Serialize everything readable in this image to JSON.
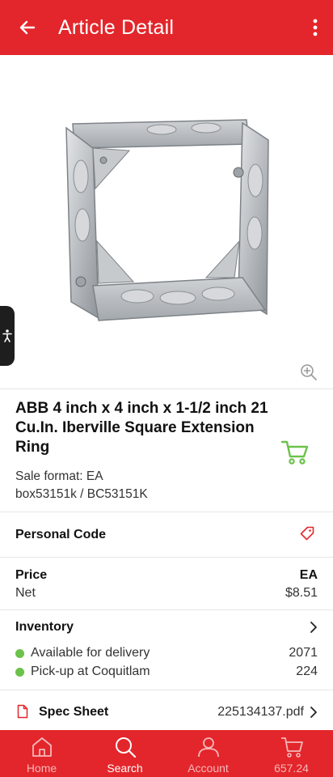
{
  "appbar": {
    "title": "Article Detail",
    "back_icon": "arrow-left-icon",
    "menu_icon": "more-vertical-icon"
  },
  "product": {
    "image_alt": "Square extension ring product photo",
    "name": "ABB 4 inch x 4 inch x 1-1/2 inch 21 Cu.In. Iberville Square Extension Ring",
    "sale_format": "Sale format: EA",
    "codes": "box53151k / BC53151K"
  },
  "personal_code": {
    "label": "Personal Code"
  },
  "price": {
    "label": "Price",
    "unit": "EA",
    "net_label": "Net",
    "net_value": "$8.51"
  },
  "inventory": {
    "label": "Inventory",
    "items": [
      {
        "label": "Available for delivery",
        "value": "2071"
      },
      {
        "label": "Pick-up at Coquitlam",
        "value": "224"
      }
    ]
  },
  "spec_sheet": {
    "label": "Spec Sheet",
    "file": "225134137.pdf"
  },
  "nav": {
    "items": [
      {
        "label": "Home",
        "icon": "home-icon",
        "active": false
      },
      {
        "label": "Search",
        "icon": "search-icon",
        "active": true
      },
      {
        "label": "Account",
        "icon": "user-icon",
        "active": false
      },
      {
        "label": "657.24",
        "icon": "cart-icon",
        "active": false
      }
    ]
  },
  "colors": {
    "primary": "#e3262b",
    "in_stock": "#6cc24a",
    "cart_green": "#6cc24a"
  }
}
